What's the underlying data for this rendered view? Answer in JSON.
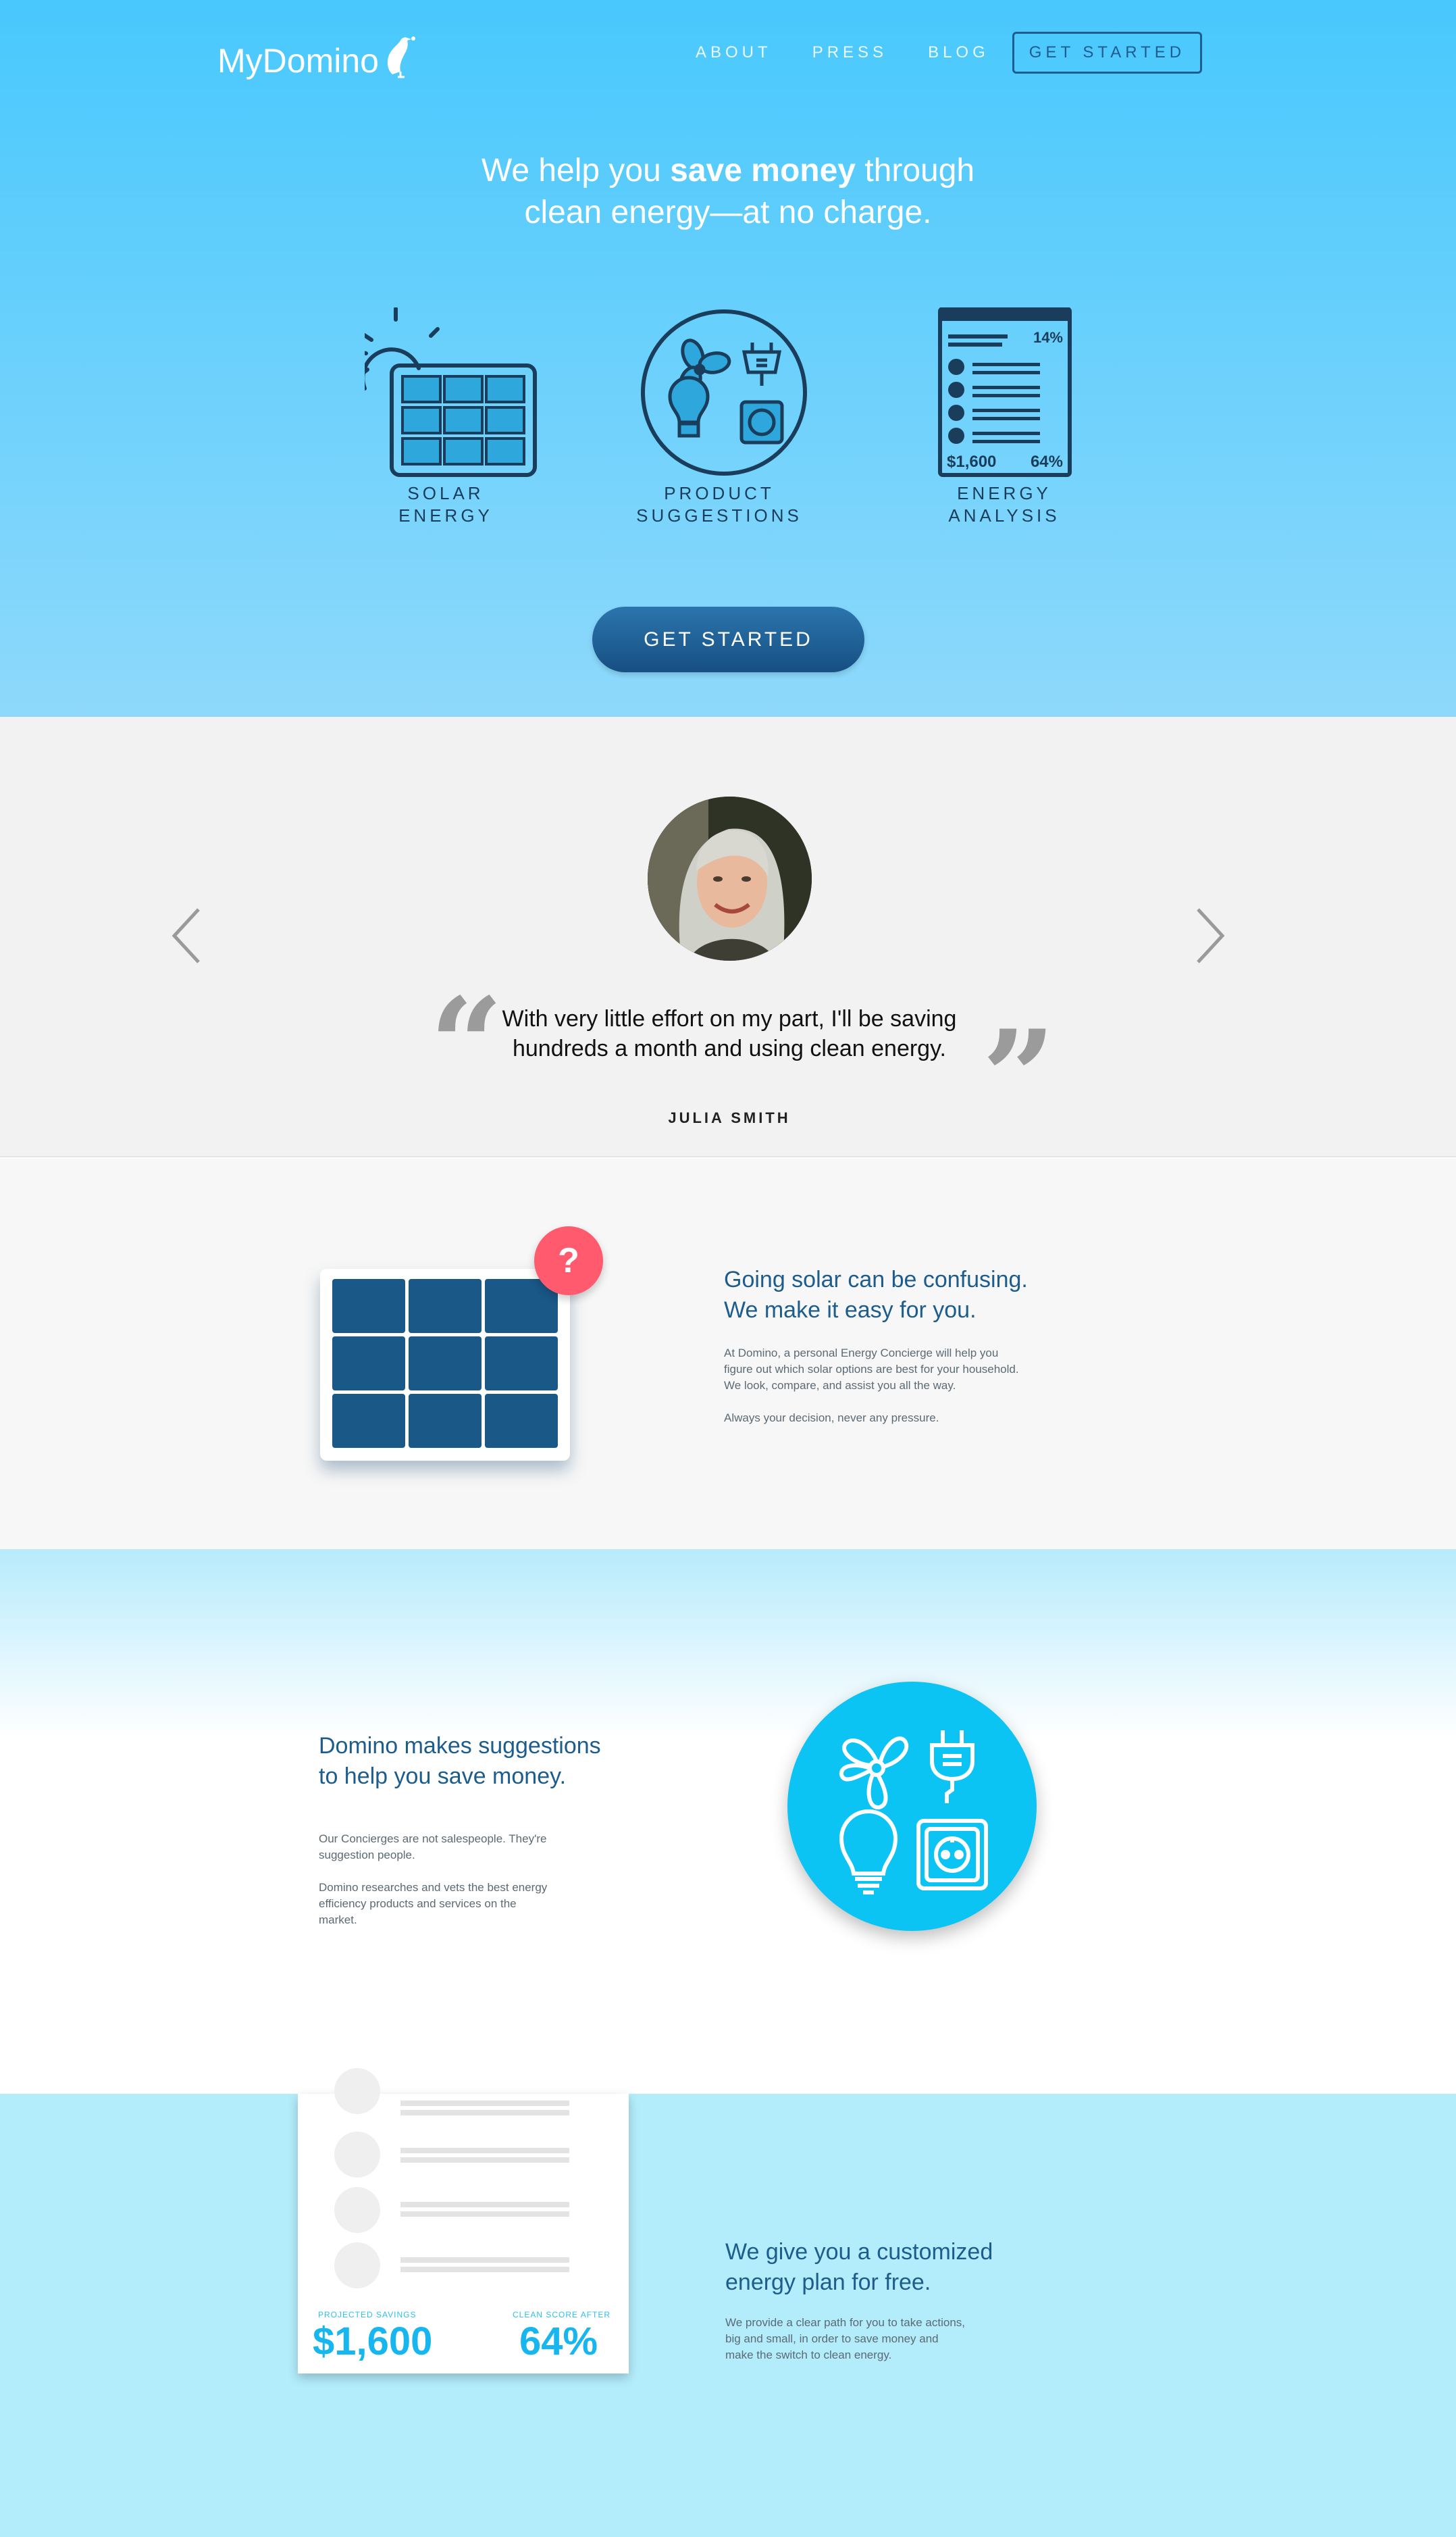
{
  "header": {
    "logo_text": "MyDomino",
    "nav": [
      {
        "label": "ABOUT"
      },
      {
        "label": "PRESS"
      },
      {
        "label": "BLOG"
      }
    ],
    "cta_label": "GET STARTED"
  },
  "hero": {
    "headline_pre": "We help you ",
    "headline_bold": "save money",
    "headline_post": " through",
    "headline_line2": "clean energy—at no charge.",
    "features": [
      {
        "line1": "SOLAR",
        "line2": "ENERGY",
        "icon": "solar-panel-icon"
      },
      {
        "line1": "PRODUCT",
        "line2": "SUGGESTIONS",
        "icon": "product-suggestions-icon"
      },
      {
        "line1": "ENERGY",
        "line2": "ANALYSIS",
        "icon": "energy-report-icon"
      }
    ],
    "report_icon": {
      "percent_top": "14%",
      "amount": "$1,600",
      "percent_bottom": "64%"
    },
    "cta_label": "GET STARTED"
  },
  "testimonial": {
    "quote_line1": "With very little effort on my part, I'll be saving",
    "quote_line2": "hundreds a month and using clean energy.",
    "author": "JULIA SMITH"
  },
  "solar": {
    "heading_line1": "Going solar can be confusing.",
    "heading_line2": "We make it easy for you.",
    "body_line1": "At Domino, a personal Energy Concierge will help you",
    "body_line2": "figure out which solar options are best for your household.",
    "body_line3": "We look, compare, and assist you all the way.",
    "body_line4": "Always your decision, never any pressure.",
    "badge": "?"
  },
  "suggestions": {
    "heading_line1": "Domino makes suggestions",
    "heading_line2": "to help you save money.",
    "body_line1": "Our Concierges are not salespeople. They're",
    "body_line2": "suggestion people.",
    "body_line3": "Domino researches and vets the best energy",
    "body_line4": "efficiency products and services on the",
    "body_line5": "market."
  },
  "plan": {
    "heading_line1": "We give you a customized",
    "heading_line2": "energy plan for free.",
    "body_line1": "We provide a clear path for you to take actions,",
    "body_line2": "big and small, in order to save money and",
    "body_line3": "make the switch to clean energy.",
    "savings_label": "PROJECTED SAVINGS",
    "savings_value": "$1,600",
    "score_label": "CLEAN SCORE AFTER",
    "score_value": "64%"
  },
  "colors": {
    "sky": "#48c8fd",
    "navy": "#1b3d5c",
    "cta": "#1f5f95",
    "accent": "#0bc4f4",
    "badge": "#ff5a6e"
  }
}
